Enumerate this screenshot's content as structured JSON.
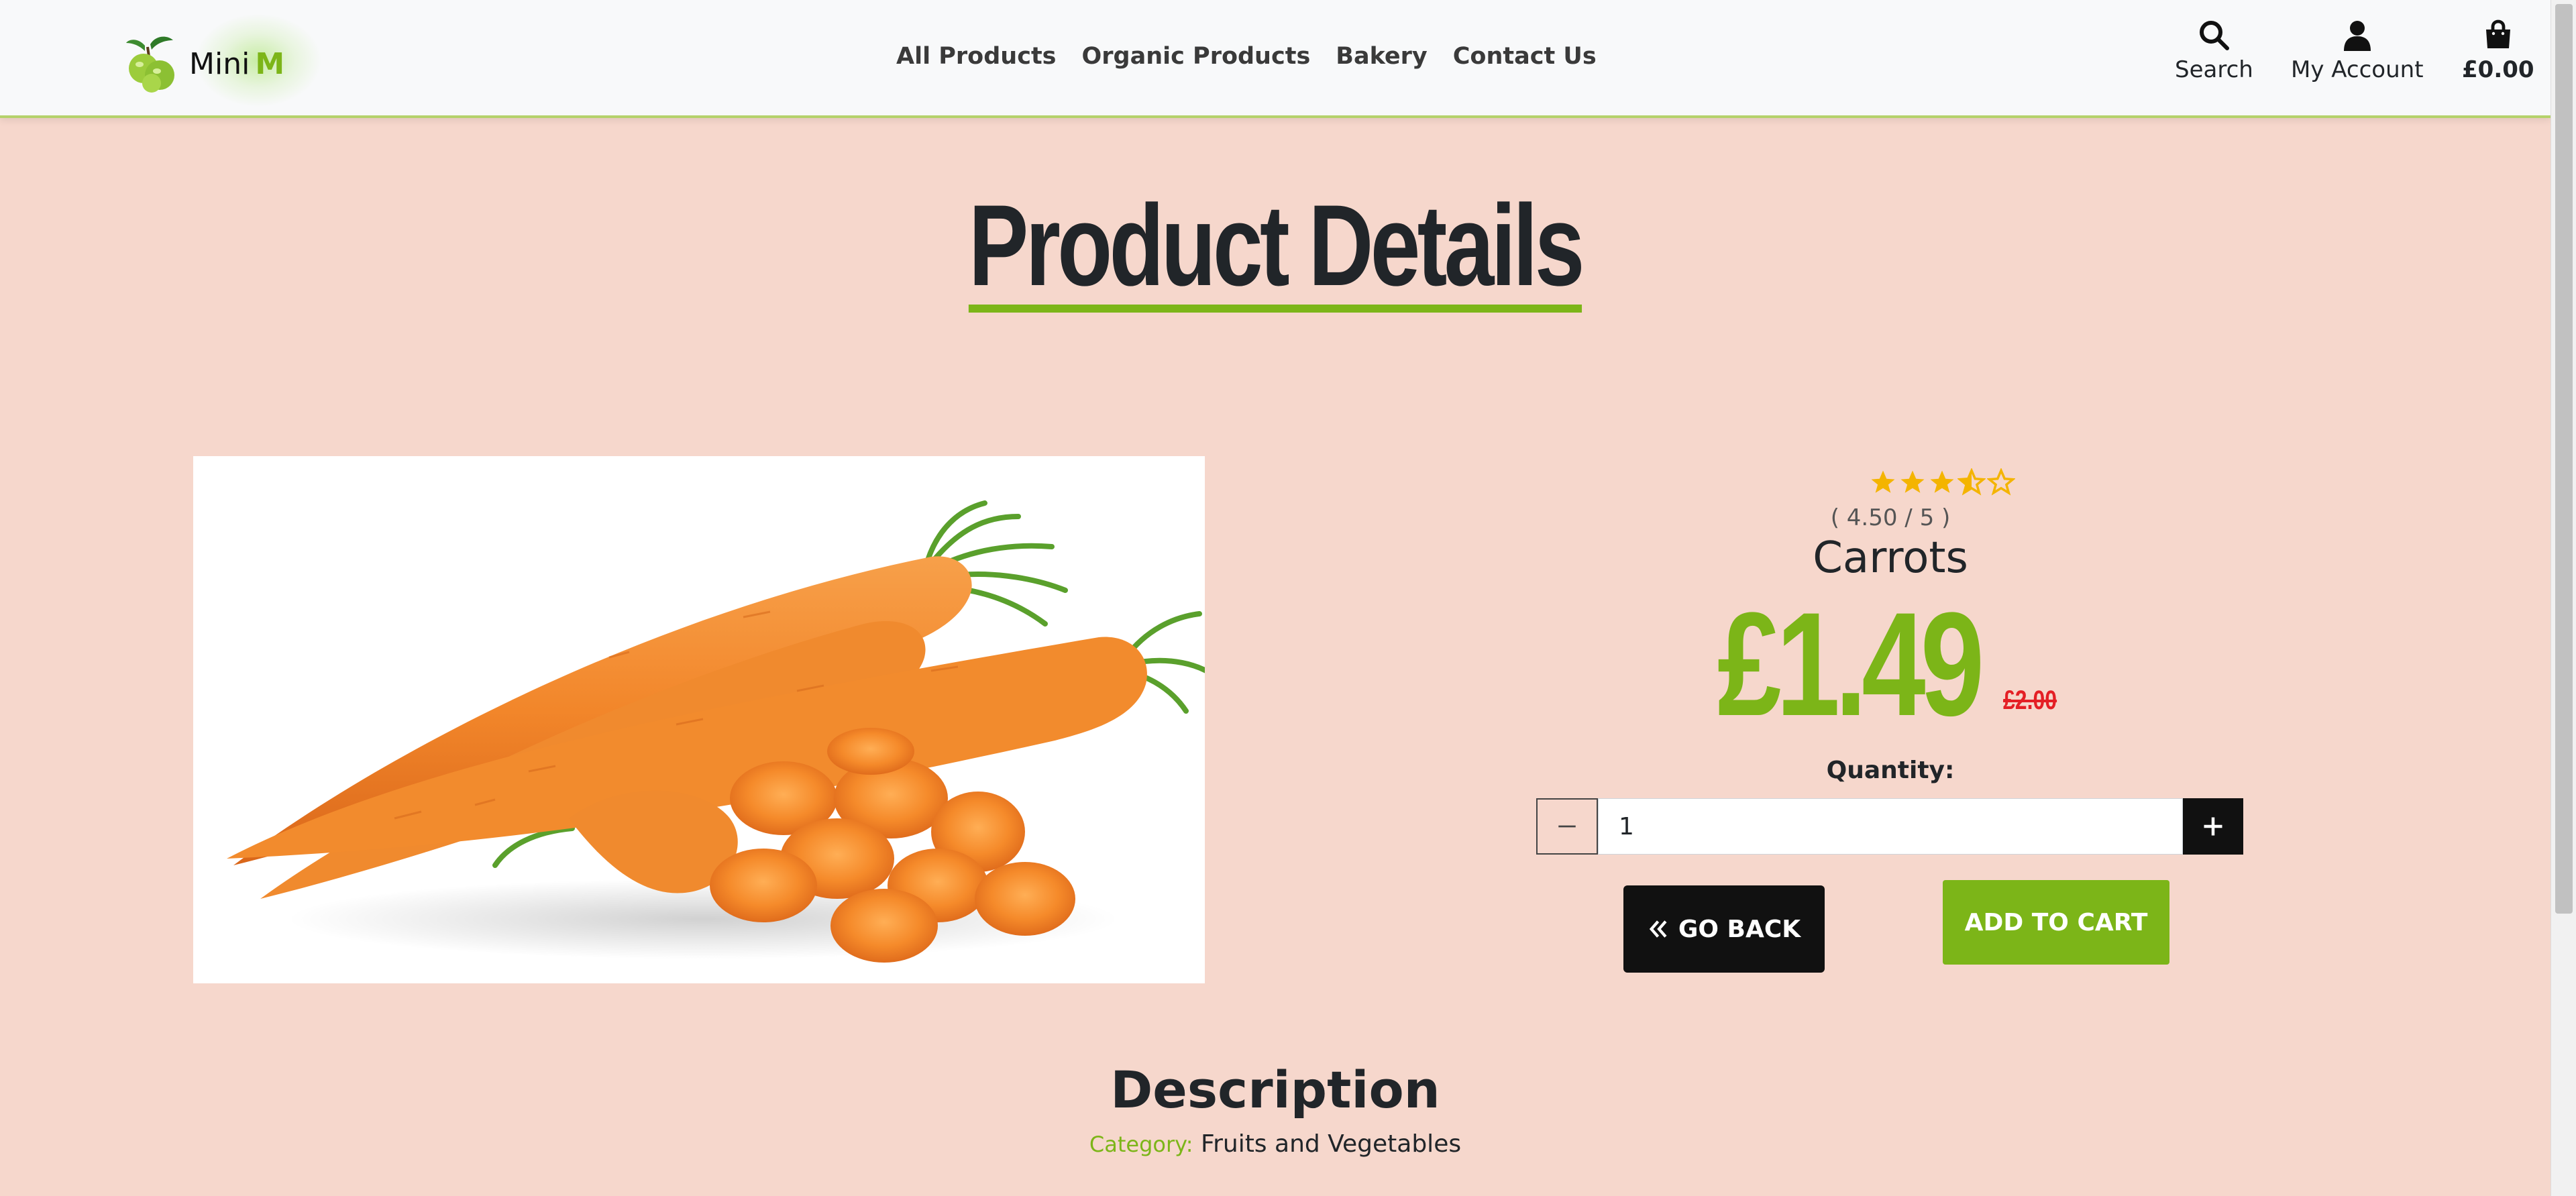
{
  "header": {
    "brand_text": "Mini",
    "brand_m": "M",
    "nav_links": [
      "All Products",
      "Organic Products",
      "Bakery",
      "Contact Us"
    ],
    "search_label": "Search",
    "account_label": "My Account",
    "cart_total": "£0.00"
  },
  "page": {
    "title": "Product Details"
  },
  "product": {
    "name": "Carrots",
    "rating": 4.5,
    "rating_text": "( 4.50 / 5 )",
    "price": "£1.49",
    "old_price": "£2.00",
    "quantity_label": "Quantity:",
    "quantity": "1",
    "go_back_label": "GO BACK",
    "add_to_cart_label": "ADD TO CART",
    "image_icon": "carrots-photo"
  },
  "description": {
    "title": "Description",
    "category_label": "Category:",
    "category_value": "Fruits and Vegetables"
  },
  "colors": {
    "accent": "#7cb518",
    "background": "#f6d7cc",
    "sale": "#e41f25",
    "star": "#f4b400"
  }
}
